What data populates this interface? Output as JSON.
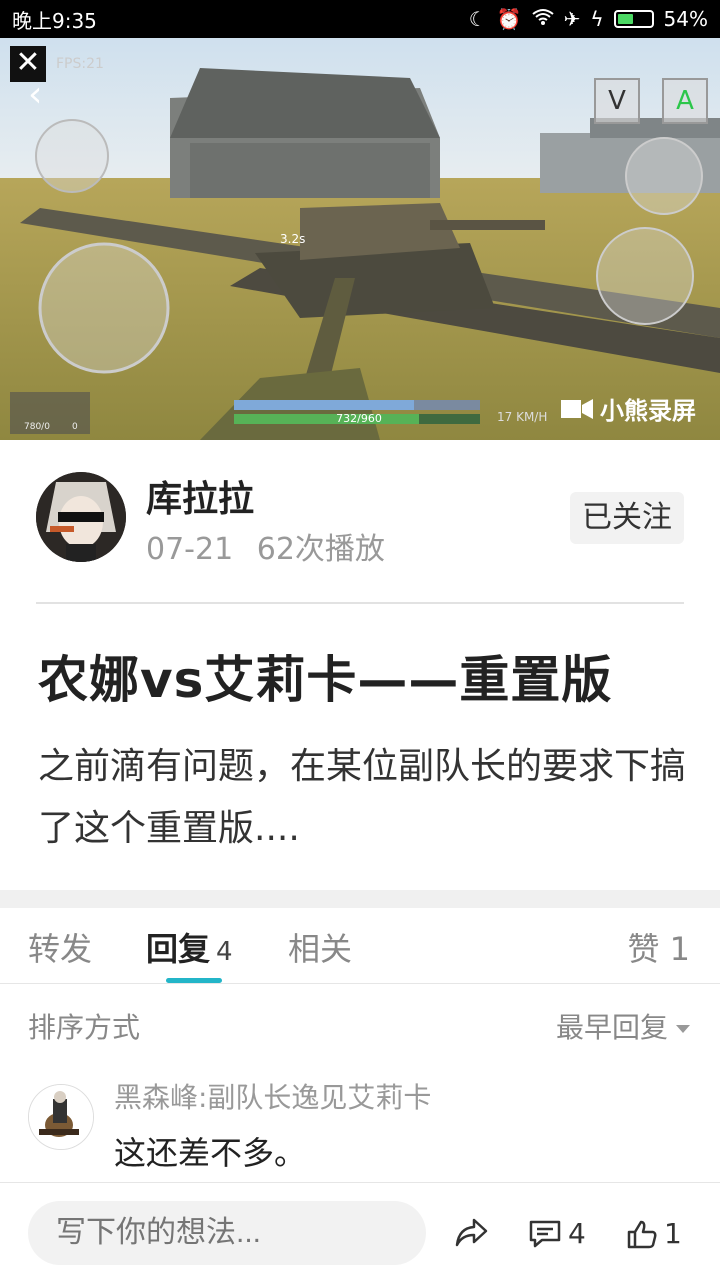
{
  "status": {
    "time": "晚上9:35",
    "battery": "54%",
    "battery_level": 0.54
  },
  "video": {
    "fps": "FPS:21",
    "hud_v": "V",
    "hud_a": "A",
    "timer": "3.2s",
    "hp": "732/960",
    "speed": "17 KM/H",
    "watermark": "小熊录屏",
    "minimap_left": "780/0",
    "minimap_right": "0"
  },
  "author": {
    "name": "库拉拉",
    "date": "07-21",
    "plays": "62次播放",
    "follow_label": "已关注"
  },
  "post": {
    "title": "农娜vs艾莉卡——重置版",
    "body": "之前滴有问题，在某位副队长的要求下搞了这个重置版...."
  },
  "tabs": {
    "forward": "转发",
    "reply": "回复",
    "reply_count": "4",
    "related": "相关",
    "like": "赞 1"
  },
  "sort": {
    "label": "排序方式",
    "value": "最早回复"
  },
  "comments": [
    {
      "user": "黑森峰:副队长逸见艾莉卡",
      "text": "这还差不多。"
    }
  ],
  "bottom": {
    "placeholder": "写下你的想法...",
    "comment_count": "4",
    "like_count": "1"
  },
  "icons": [
    "close-icon",
    "back-chevron-icon",
    "share-icon",
    "comment-icon",
    "thumbs-up-icon",
    "wifi-icon",
    "airplane-icon",
    "alarm-icon",
    "moon-icon"
  ]
}
